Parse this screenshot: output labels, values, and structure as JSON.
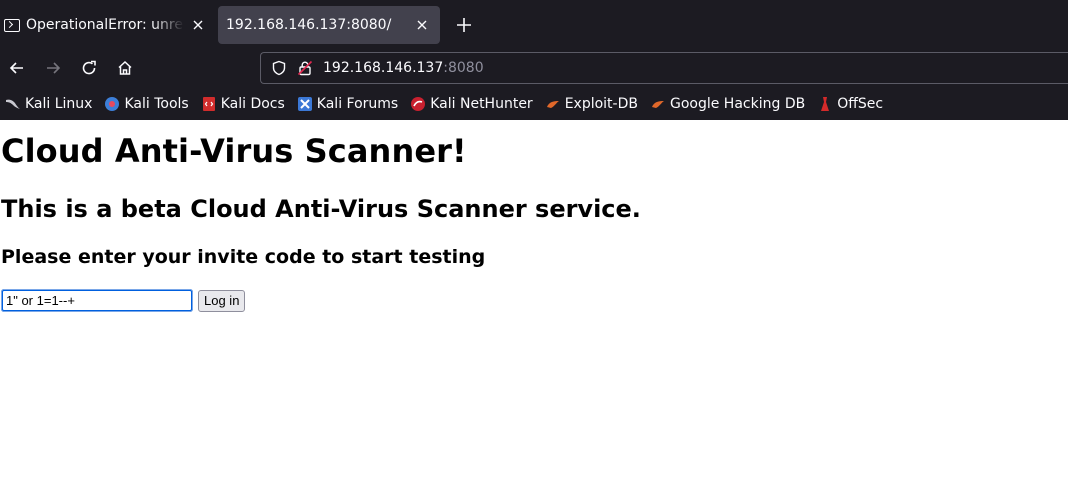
{
  "tabs": [
    {
      "title": "OperationalError: unrecognized token",
      "active": false
    },
    {
      "title": "192.168.146.137:8080/",
      "active": true
    }
  ],
  "url": {
    "host": "192.168.146.137",
    "port": ":8080"
  },
  "bookmarks": [
    {
      "label": "Kali Linux",
      "icon": "kali-dragon-icon"
    },
    {
      "label": "Kali Tools",
      "icon": "kali-tools-icon"
    },
    {
      "label": "Kali Docs",
      "icon": "kali-docs-icon"
    },
    {
      "label": "Kali Forums",
      "icon": "kali-forums-icon"
    },
    {
      "label": "Kali NetHunter",
      "icon": "kali-nethunter-icon"
    },
    {
      "label": "Exploit-DB",
      "icon": "exploit-db-icon"
    },
    {
      "label": "Google Hacking DB",
      "icon": "ghdb-icon"
    },
    {
      "label": "OffSec",
      "icon": "offsec-icon"
    }
  ],
  "page": {
    "heading": "Cloud Anti-Virus Scanner!",
    "subheading": "This is a beta Cloud Anti-Virus Scanner service.",
    "prompt": "Please enter your invite code to start testing",
    "invite_value": "1\" or 1=1--+",
    "login_label": "Log in"
  },
  "colors": {
    "chrome_bg": "#1c1b22",
    "active_tab": "#42414d",
    "focus": "#0060df"
  }
}
